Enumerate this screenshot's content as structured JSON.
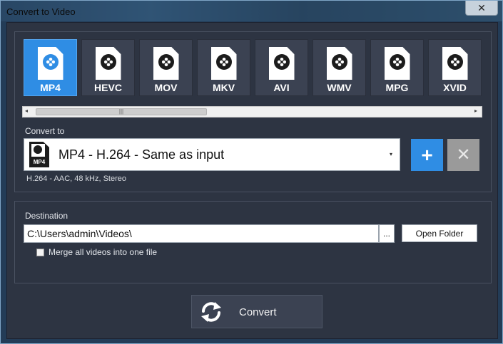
{
  "window": {
    "title": "Convert to Video",
    "close_label": "✕"
  },
  "formats": [
    {
      "label": "MP4",
      "selected": true
    },
    {
      "label": "HEVC",
      "selected": false
    },
    {
      "label": "MOV",
      "selected": false
    },
    {
      "label": "MKV",
      "selected": false
    },
    {
      "label": "AVI",
      "selected": false
    },
    {
      "label": "WMV",
      "selected": false
    },
    {
      "label": "MPG",
      "selected": false
    },
    {
      "label": "XVID",
      "selected": false
    }
  ],
  "scrollbar": {
    "left_arrow": "◂",
    "right_arrow": "▸",
    "thumb_grip": "|||"
  },
  "convert_to": {
    "label": "Convert to",
    "selected_value": "MP4 - H.264 - Same as input",
    "file_tag": "MP4",
    "caret": "▾",
    "codec_info": "H.264  -  AAC,  48 kHz,  Stereo",
    "add_label": "+",
    "remove_label": "✕"
  },
  "destination": {
    "label": "Destination",
    "path": "C:\\Users\\admin\\Videos\\",
    "browse_label": "...",
    "open_folder_label": "Open Folder",
    "merge_label": "Merge all videos into one file",
    "merge_checked": false
  },
  "convert_button": {
    "label": "Convert"
  },
  "colors": {
    "accent": "#2f8de4",
    "panel": "#2d3442",
    "tile": "#3b4252"
  }
}
